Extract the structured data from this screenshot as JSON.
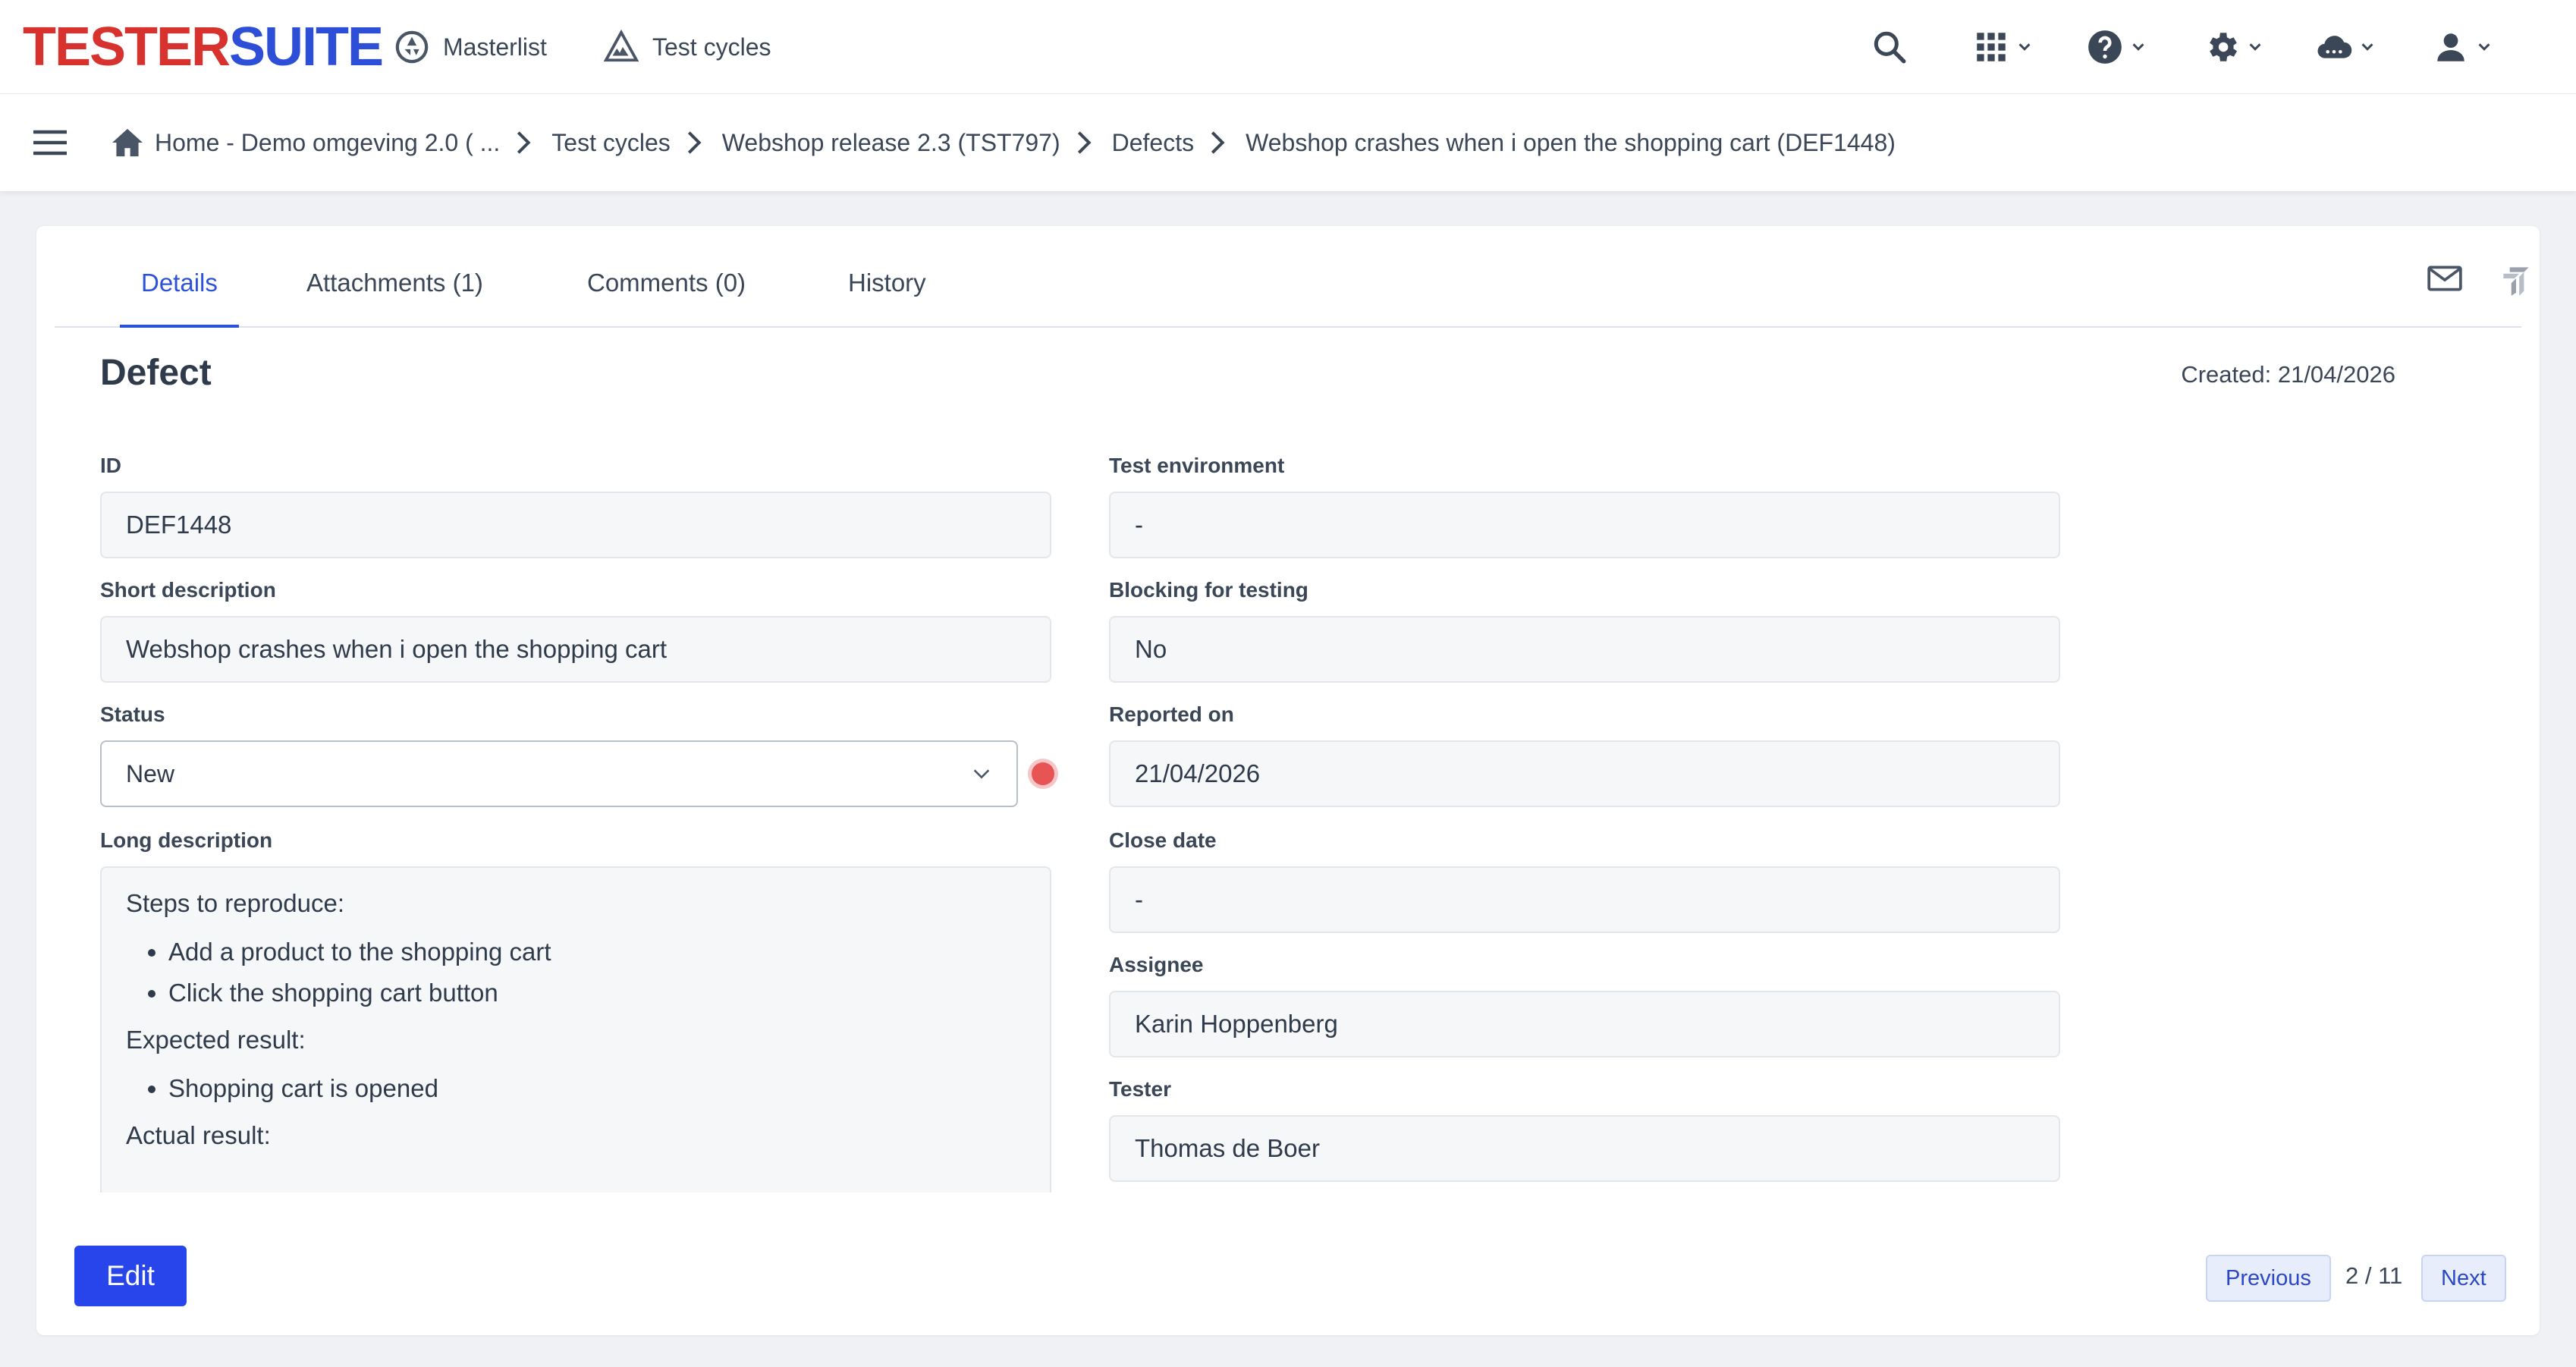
{
  "app": {
    "logo_part1": "TESTER",
    "logo_part2": "SUITE"
  },
  "topnav": {
    "masterlist": "Masterlist",
    "test_cycles": "Test cycles"
  },
  "topbar_icons": [
    "search-icon",
    "apps-grid-icon",
    "help-icon",
    "settings-gear-icon",
    "cloud-icon",
    "user-icon"
  ],
  "breadcrumb": [
    "Home - Demo omgeving 2.0 ( ...",
    "Test cycles",
    "Webshop release 2.3 (TST797)",
    "Defects",
    "Webshop crashes when i open the shopping cart (DEF1448)"
  ],
  "tabs": [
    "Details",
    "Attachments (1)",
    "Comments (0)",
    "History"
  ],
  "active_tab": "Details",
  "section_title": "Defect",
  "created": "Created: 21/04/2026",
  "left_fields": {
    "id_label": "ID",
    "id_value": "DEF1448",
    "short_label": "Short description",
    "short_value": "Webshop crashes when i open the shopping cart",
    "status_label": "Status",
    "status_value": "New",
    "long_label": "Long description"
  },
  "long_description": {
    "steps_heading": "Steps to reproduce:",
    "steps": [
      "Add a product to the shopping cart",
      "Click the shopping cart button"
    ],
    "expected_heading": "Expected result:",
    "expected": [
      "Shopping cart is opened"
    ],
    "actual_heading": "Actual result:"
  },
  "right_fields": {
    "env_label": "Test environment",
    "env_value": "-",
    "blocking_label": "Blocking for testing",
    "blocking_value": "No",
    "reported_label": "Reported on",
    "reported_value": "21/04/2026",
    "close_label": "Close date",
    "close_value": "-",
    "assignee_label": "Assignee",
    "assignee_value": "Karin Hoppenberg",
    "tester_label": "Tester",
    "tester_value": "Thomas de Boer"
  },
  "actions": {
    "edit": "Edit",
    "previous": "Previous",
    "next": "Next",
    "counter": "2 / 11"
  },
  "colors": {
    "accent": "#2b52d9",
    "logo_red": "#d8322e",
    "logo_blue": "#2d4fd8",
    "status_new": "#e85454"
  }
}
